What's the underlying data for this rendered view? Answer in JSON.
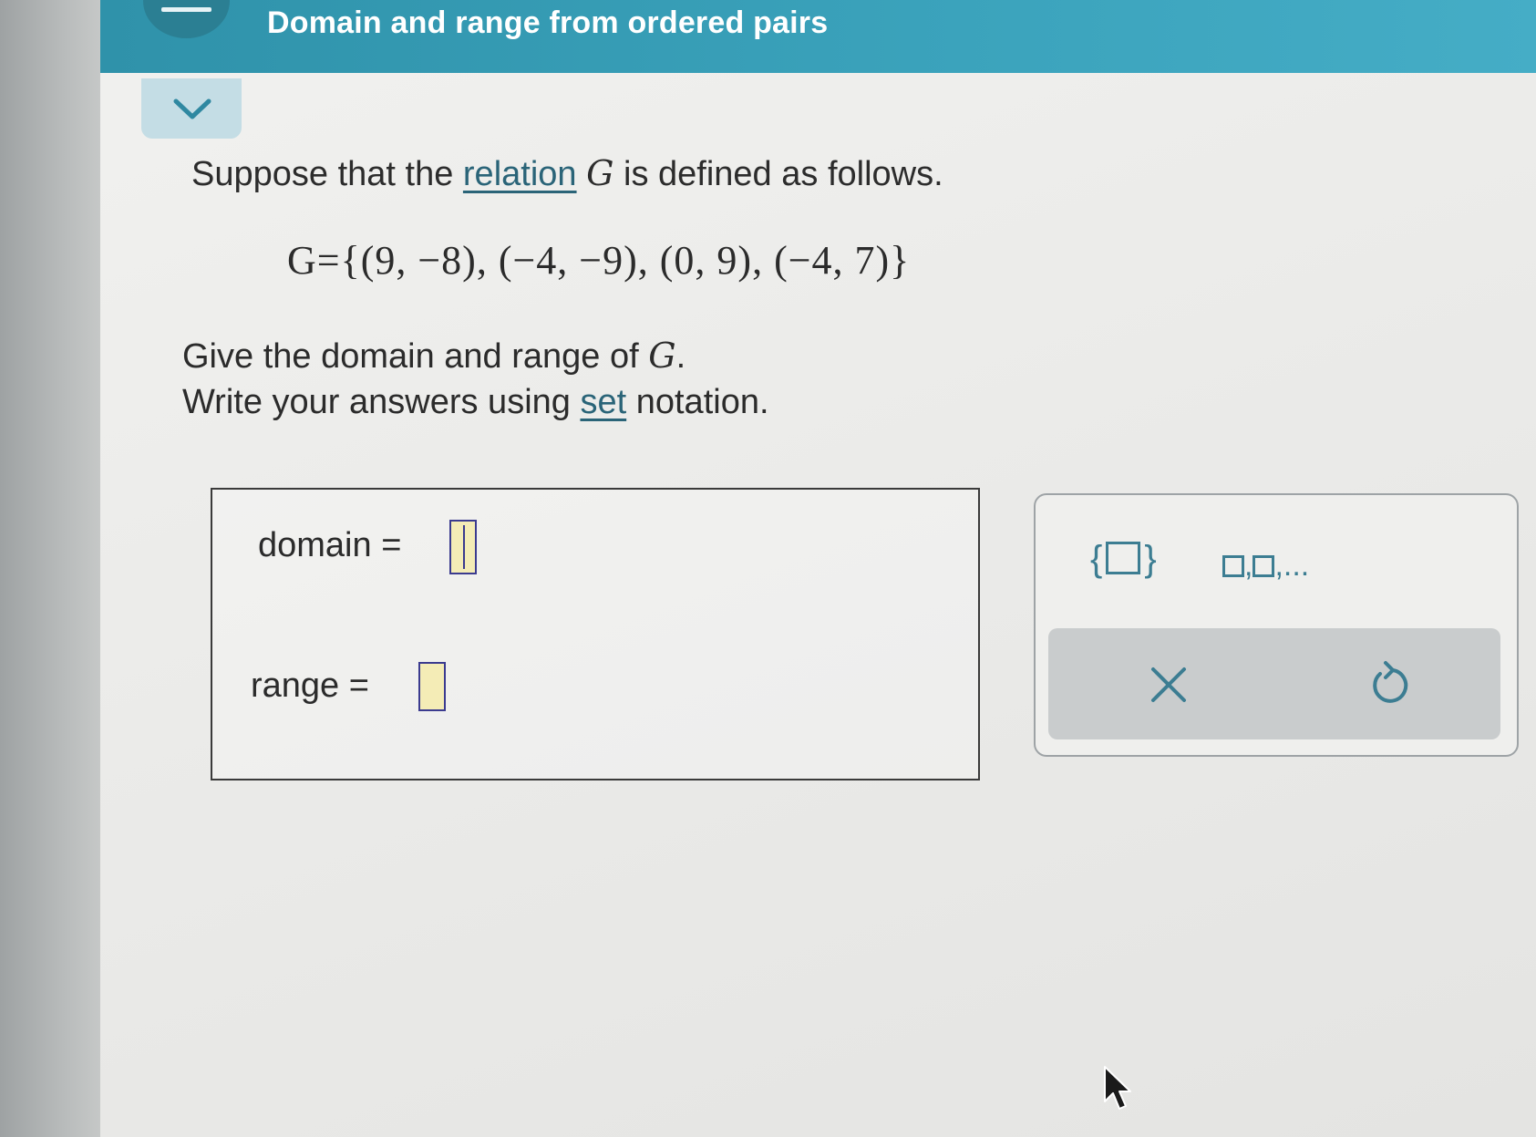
{
  "header": {
    "title": "Domain and range from ordered pairs"
  },
  "problem": {
    "intro_prefix": "Suppose that the ",
    "intro_link": "relation",
    "intro_var": "G",
    "intro_suffix": " is defined as follows.",
    "equation": "G={(9, −8), (−4, −9), (0, 9), (−4, 7)}",
    "instruction_prefix": "Give the domain and range of ",
    "instruction_var": "G",
    "instruction_suffix": ".",
    "notation_prefix": "Write your answers using ",
    "notation_link": "set",
    "notation_suffix": " notation."
  },
  "answers": {
    "domain_label": "domain =",
    "domain_value": "",
    "range_label": "range =",
    "range_value": ""
  },
  "keypad": {
    "set_key_open": "{",
    "set_key_close": "}",
    "list_key_separator": ",",
    "list_key_ellipsis": ",..."
  },
  "colors": {
    "header": "#3ba3bc",
    "accent": "#3c7d92",
    "input_fill": "#f4ecb6",
    "input_border": "#3b3b8f"
  }
}
